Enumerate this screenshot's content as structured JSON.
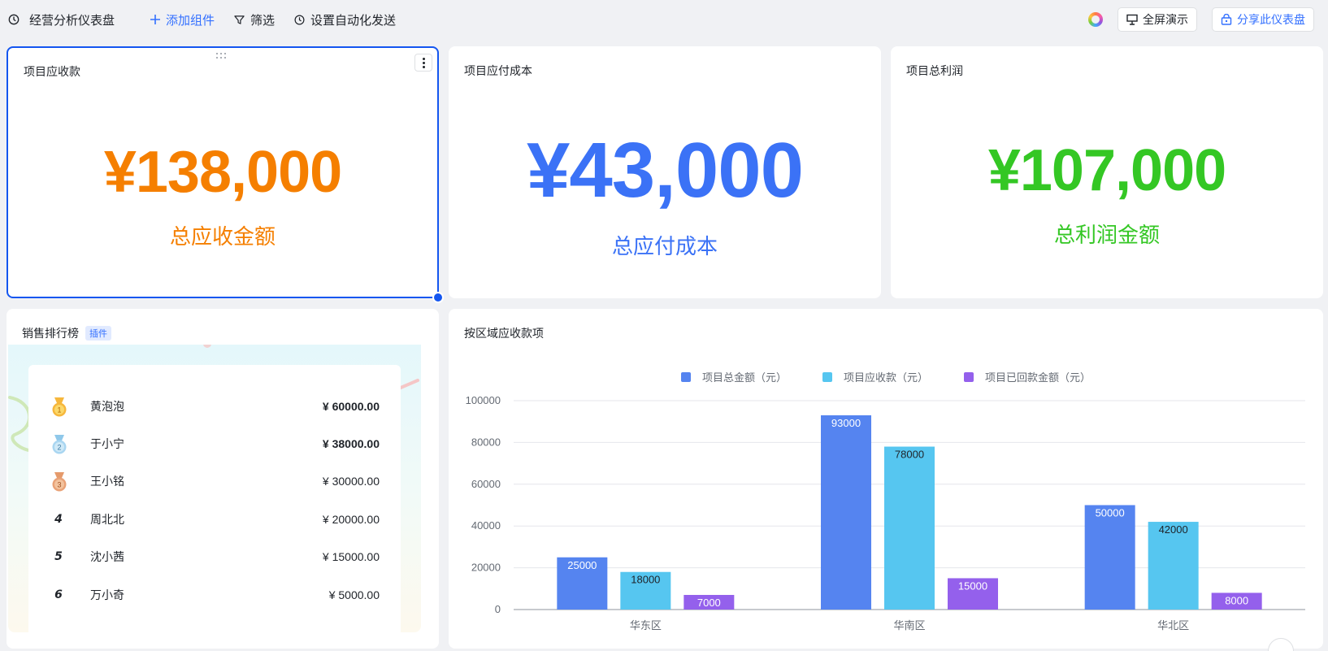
{
  "toolbar": {
    "title": "经营分析仪表盘",
    "add_component": "添加组件",
    "filter": "筛选",
    "automation": "设置自动化发送",
    "fullscreen": "全屏演示",
    "share": "分享此仪表盘"
  },
  "kpis": [
    {
      "title": "项目应收款",
      "value": "¥138,000",
      "label": "总应收金额",
      "color": "#f57f00"
    },
    {
      "title": "项目应付成本",
      "value": "¥43,000",
      "label": "总应付成本",
      "color": "#3b72f6"
    },
    {
      "title": "项目总利润",
      "value": "¥107,000",
      "label": "总利润金额",
      "color": "#34c724"
    }
  ],
  "ranking": {
    "title": "销售排行榜",
    "badge": "插件",
    "rows": [
      {
        "pos": "1",
        "name": "黄泡泡",
        "amount": "¥ 60000.00",
        "medal": "gold"
      },
      {
        "pos": "2",
        "name": "于小宁",
        "amount": "¥ 38000.00",
        "medal": "silver"
      },
      {
        "pos": "3",
        "name": "王小铭",
        "amount": "¥ 30000.00",
        "medal": "bronze"
      },
      {
        "pos": "4",
        "name": "周北北",
        "amount": "¥ 20000.00"
      },
      {
        "pos": "5",
        "name": "沈小茜",
        "amount": "¥ 15000.00"
      },
      {
        "pos": "6",
        "name": "万小奇",
        "amount": "¥ 5000.00"
      }
    ]
  },
  "chart_card": {
    "title": "按区域应收款项"
  },
  "chart_data": {
    "type": "bar",
    "categories": [
      "华东区",
      "华南区",
      "华北区"
    ],
    "series": [
      {
        "name": "项目总金额（元）",
        "color": "#5584f0",
        "values": [
          25000,
          93000,
          50000
        ]
      },
      {
        "name": "项目应收款（元）",
        "color": "#56c6f0",
        "values": [
          18000,
          78000,
          42000
        ]
      },
      {
        "name": "项目已回款金额（元）",
        "color": "#9460ec",
        "values": [
          7000,
          15000,
          8000
        ]
      }
    ],
    "ylim": [
      0,
      100000
    ],
    "yticks": [
      0,
      20000,
      40000,
      60000,
      80000,
      100000
    ],
    "grid": true,
    "legend": "top"
  }
}
